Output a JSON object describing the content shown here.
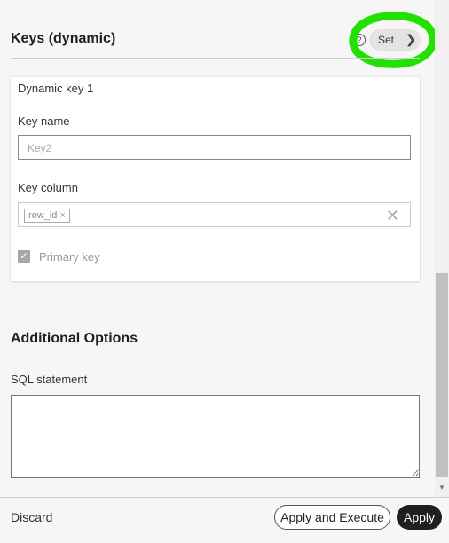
{
  "keys_section": {
    "title": "Keys (dynamic)",
    "help_icon": "?",
    "set_button": {
      "label": "Set",
      "chevron": "❯"
    },
    "highlight_color": "#22e000"
  },
  "dynamic_key": {
    "header": "Dynamic key 1",
    "key_name": {
      "label": "Key name",
      "placeholder": "Key2"
    },
    "key_column": {
      "label": "Key column",
      "chip": "row_id",
      "chip_remove": "×",
      "clear": "✕"
    },
    "primary_key": {
      "label": "Primary key",
      "checked": true
    }
  },
  "additional_options": {
    "title": "Additional Options",
    "sql_label": "SQL statement",
    "sql_value": ""
  },
  "footer": {
    "discard": "Discard",
    "apply_execute": "Apply and Execute",
    "apply": "Apply"
  }
}
